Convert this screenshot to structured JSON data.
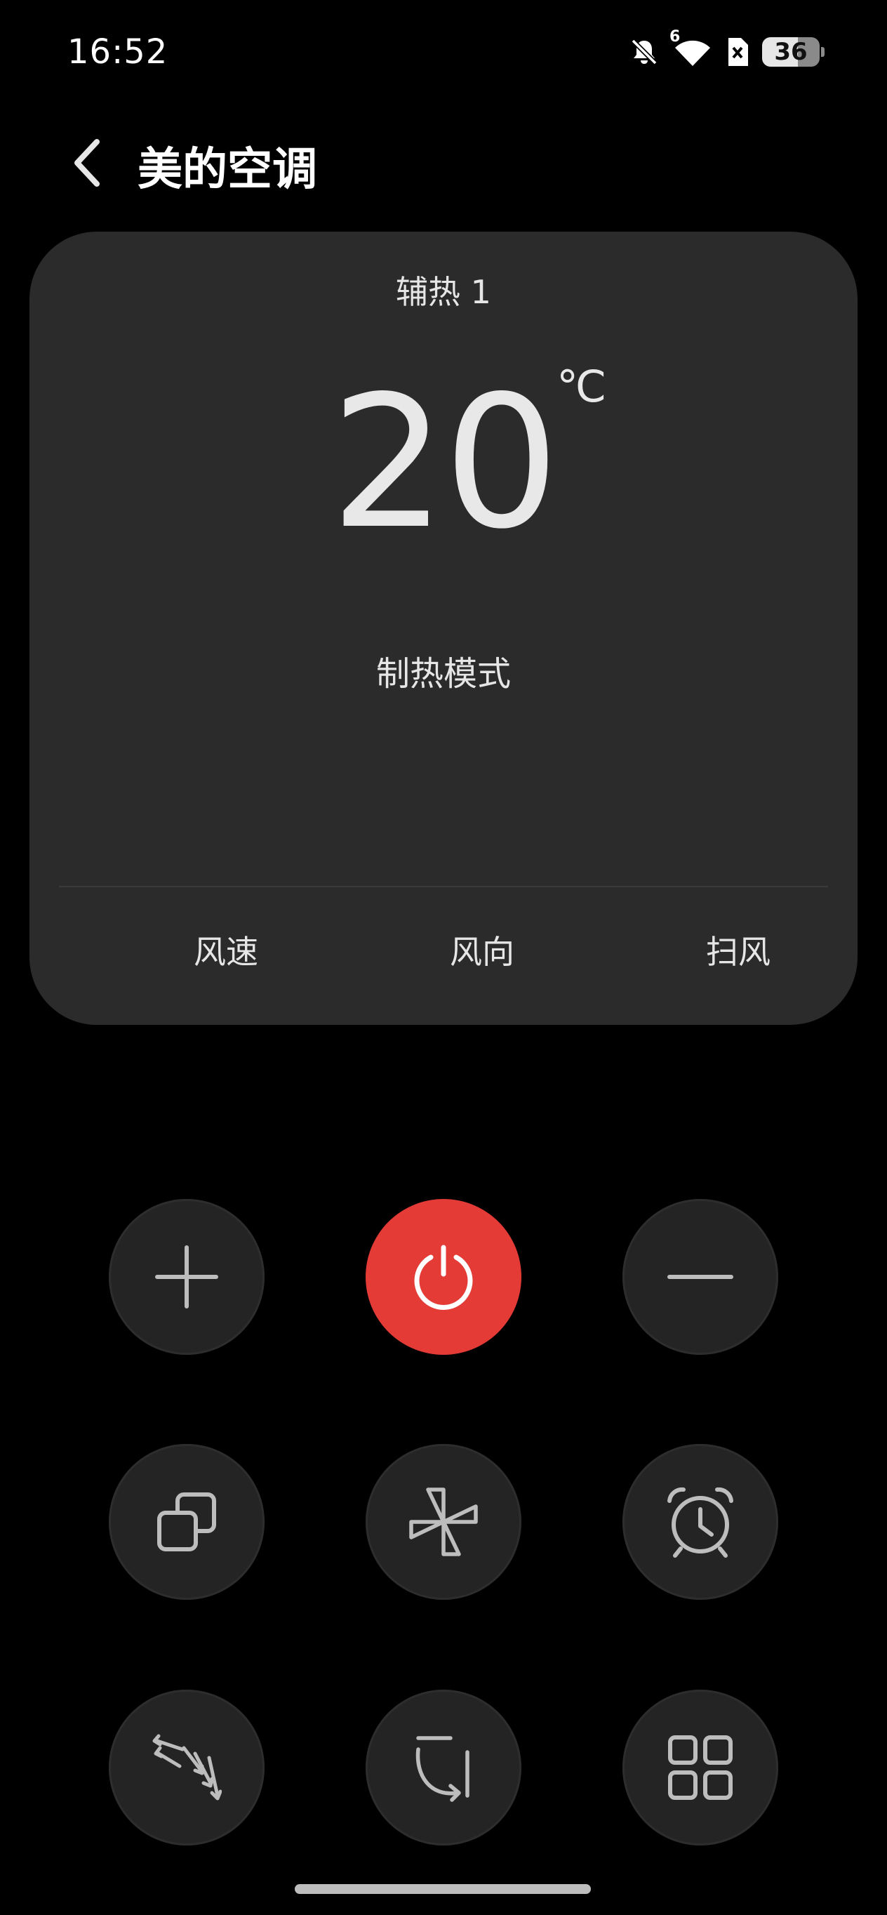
{
  "status_bar": {
    "time": "16:52",
    "wifi_badge": "6",
    "battery": "36",
    "icons": [
      "bell-off-icon",
      "wifi-icon",
      "sim-off-icon",
      "battery-icon"
    ]
  },
  "header": {
    "title": "美的空调",
    "back_icon": "chevron-left-icon"
  },
  "card": {
    "aux_heat": "辅热 1",
    "temperature": "20",
    "unit": "°C",
    "mode": "制热模式",
    "tabs": [
      {
        "label": "风速"
      },
      {
        "label": "风向"
      },
      {
        "label": "扫风"
      }
    ]
  },
  "controls": [
    {
      "name": "increase-temp-button",
      "icon": "plus-icon"
    },
    {
      "name": "power-button",
      "icon": "power-icon"
    },
    {
      "name": "decrease-temp-button",
      "icon": "minus-icon"
    },
    {
      "name": "mode-button",
      "icon": "mode-squares-icon"
    },
    {
      "name": "fan-button",
      "icon": "fan-icon"
    },
    {
      "name": "timer-button",
      "icon": "alarm-clock-icon"
    },
    {
      "name": "swing-vertical-button",
      "icon": "swing-arrows-icon"
    },
    {
      "name": "swing-horizontal-button",
      "icon": "swing-curve-icon"
    },
    {
      "name": "more-button",
      "icon": "grid-icon"
    }
  ],
  "colors": {
    "background": "#000000",
    "card": "#2b2b2b",
    "button": "#242424",
    "power": "#e43b37",
    "text": "#e6e6e6"
  }
}
